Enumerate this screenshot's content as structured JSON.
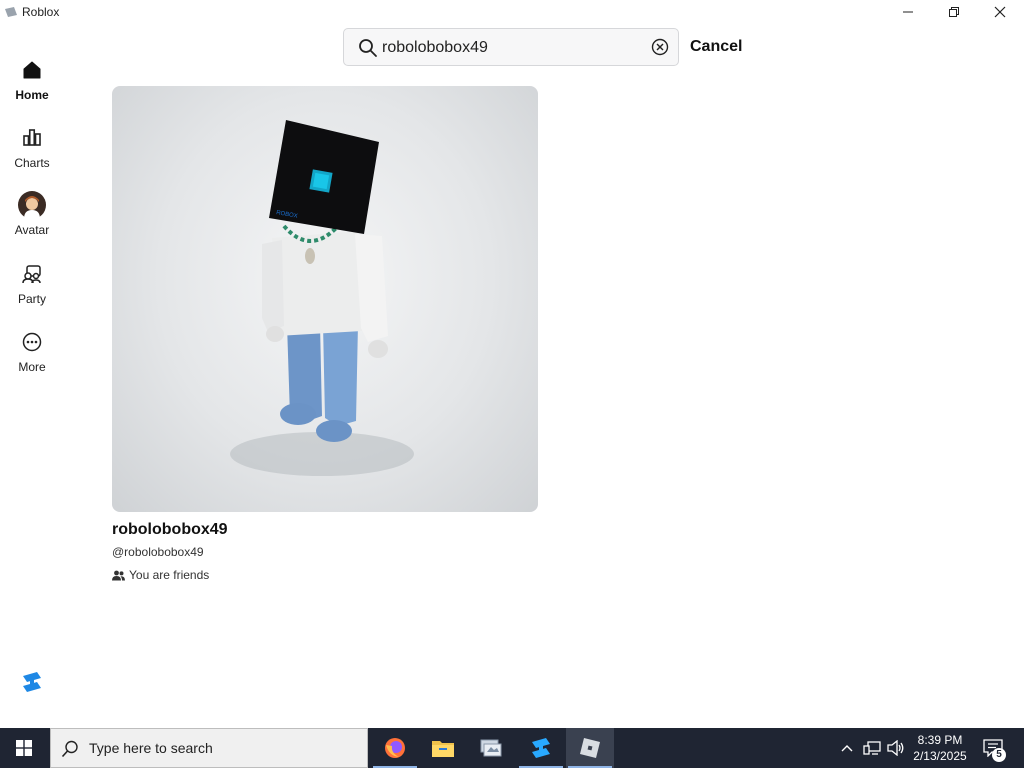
{
  "window": {
    "title": "Roblox",
    "controls": [
      "minimize-icon",
      "restore-icon",
      "close-icon"
    ]
  },
  "search": {
    "value": "robolobobox49",
    "cancel_label": "Cancel"
  },
  "sidebar": {
    "items": [
      {
        "label": "Home",
        "icon": "home-icon",
        "active": true
      },
      {
        "label": "Charts",
        "icon": "charts-icon",
        "active": false
      },
      {
        "label": "Avatar",
        "icon": "avatar-icon",
        "active": false
      },
      {
        "label": "Party",
        "icon": "party-icon",
        "active": false
      },
      {
        "label": "More",
        "icon": "more-icon",
        "active": false
      }
    ]
  },
  "result": {
    "display_name": "robolobobox49",
    "username": "@robolobobox49",
    "friend_status": "You are friends"
  },
  "taskbar": {
    "search_placeholder": "Type here to search",
    "apps": [
      "firefox-icon",
      "file-explorer-icon",
      "app-icon",
      "roblox-studio-icon",
      "roblox-icon"
    ],
    "clock": {
      "time": "8:39 PM",
      "date": "2/13/2025"
    },
    "notification_count": "5"
  },
  "colors": {
    "taskbar_bg": "#1f2533",
    "accent": "#1e88e5"
  }
}
